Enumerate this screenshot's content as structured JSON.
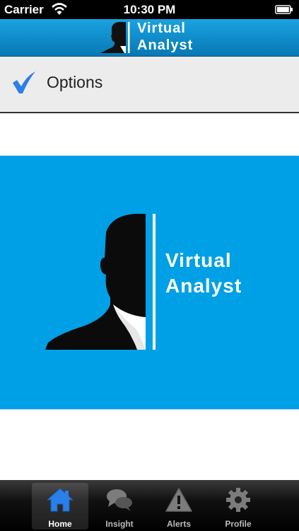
{
  "status_bar": {
    "carrier": "Carrier",
    "time": "10:30 PM",
    "icons": [
      "wifi-icon",
      "battery-icon"
    ]
  },
  "nav_bar": {
    "logo_line1": "Virtual",
    "logo_line2": "Analyst",
    "background": "#0a8bcb"
  },
  "options": {
    "label": "Options",
    "icon": "checkmark-icon",
    "check_color": "#2a7fe8"
  },
  "banner": {
    "line1": "Virtual",
    "line2": "Analyst",
    "background": "#00a0e6"
  },
  "tab_bar": {
    "tabs": [
      {
        "label": "Home",
        "icon": "home-icon",
        "active": true
      },
      {
        "label": "Insight",
        "icon": "speech-bubbles-icon",
        "active": false
      },
      {
        "label": "Alerts",
        "icon": "warning-icon",
        "active": false
      },
      {
        "label": "Profile",
        "icon": "gear-icon",
        "active": false
      }
    ],
    "active_color": "#2a7fe8"
  }
}
